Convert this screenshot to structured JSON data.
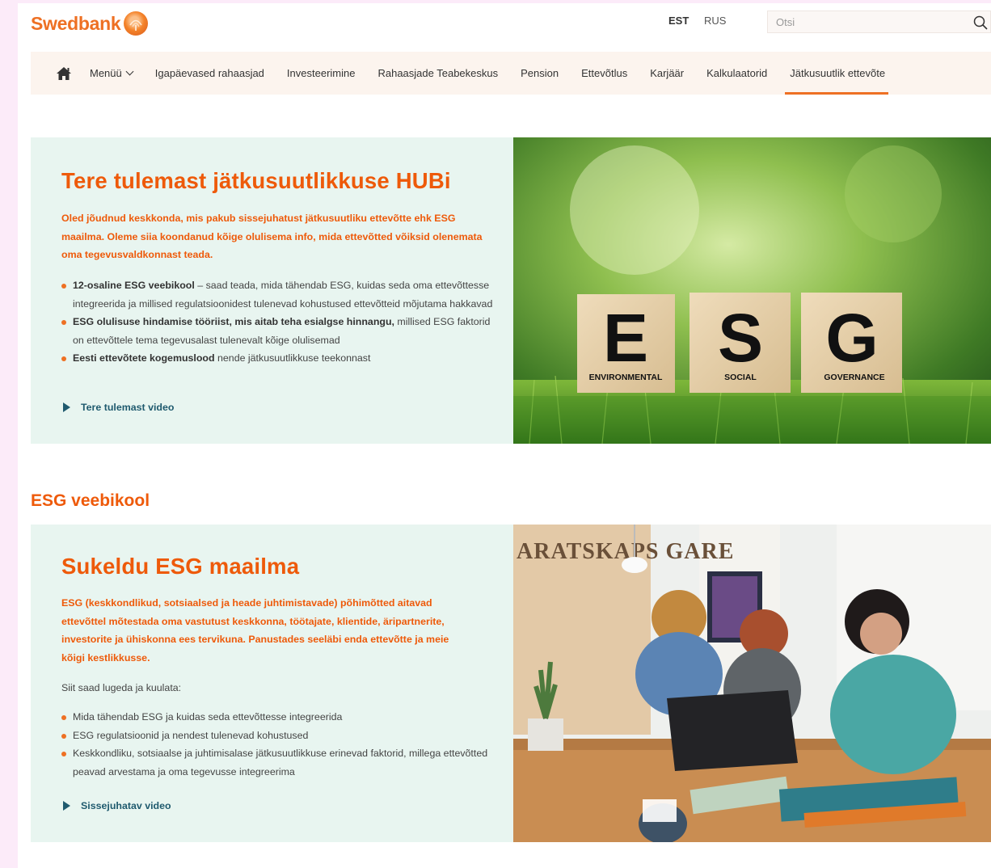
{
  "header": {
    "logo_text": "Swedbank",
    "lang_est": "EST",
    "lang_rus": "RUS",
    "search_placeholder": "Otsi"
  },
  "nav": {
    "menu_label": "Menüü",
    "items": [
      "Igapäevased rahaasjad",
      "Investeerimine",
      "Rahaasjade Teabekeskus",
      "Pension",
      "Ettevõtlus",
      "Karjäär",
      "Kalkulaatorid",
      "Jätkusuutlik ettevõte"
    ],
    "active_index": 7
  },
  "hero1": {
    "title": "Tere tulemast jätkusuutlikkuse HUBi",
    "lead": "Oled jõudnud keskkonda, mis pakub sissejuhatust jätkusuutliku ettevõtte ehk ESG maailma. Oleme siia koondanud kõige olulisema info, mida ettevõtted võiksid olenemata oma tegevusvaldkonnast teada.",
    "bullets": [
      {
        "bold": "12-osaline ESG veebikool",
        "text": " – saad teada, mida tähendab ESG, kuidas seda oma ettevõttesse integreerida ja millised regulatsioonidest tulenevad kohustused ettevõtteid mõjutama hakkavad"
      },
      {
        "bold": "ESG olulisuse hindamise tööriist, mis aitab teha esialgse hinnangu,",
        "text": " millised ESG faktorid on ettevõttele tema tegevusalast tulenevalt kõige olulisemad"
      },
      {
        "bold": "Eesti ettevõtete kogemuslood",
        "text": " nende jätkusuutlikkuse teekonnast"
      }
    ],
    "video_label": "Tere tulemast video",
    "image": {
      "letters": [
        "E",
        "S",
        "G"
      ],
      "captions": [
        "ENVIRONMENTAL",
        "SOCIAL",
        "GOVERNANCE"
      ]
    }
  },
  "section_heading": "ESG veebikool",
  "hero2": {
    "title": "Sukeldu ESG maailma",
    "lead": "ESG (keskkondlikud, sotsiaalsed ja heade juhtimistavade) põhimõtted aitavad ettevõttel mõtestada oma vastutust keskkonna, töötajate, klientide, äripartnerite, investorite ja ühiskonna ees tervikuna. Panustades seeläbi enda ettevõtte ja meie kõigi kestlikkusse.",
    "intro": "Siit saad lugeda ja kuulata:",
    "bullets": [
      "Mida tähendab ESG ja kuidas seda ettevõttesse integreerida",
      "ESG regulatsioonid ja nendest tulenevad kohustused",
      "Keskkondliku, sotsiaalse ja juhtimisalase jätkusuutlikkuse erinevad faktorid, millega ettevõtted peavad arvestama ja oma tegevusse integreerima"
    ],
    "video_label": "Sissejuhatav video",
    "image": {
      "wall_text": "ARATSKAPS GARE"
    }
  },
  "colors": {
    "brand_orange": "#ee7023",
    "heading_orange": "#ee5a0a",
    "panel_bg": "#e8f5f0",
    "link_teal": "#1f5a6e"
  }
}
